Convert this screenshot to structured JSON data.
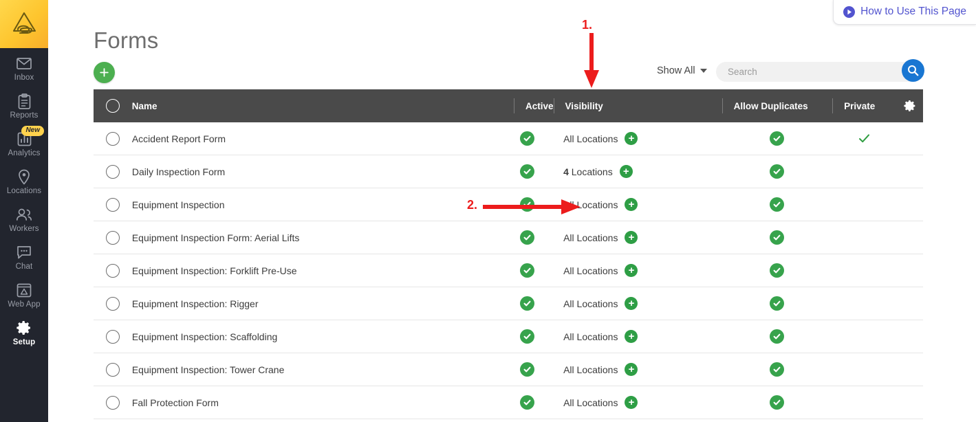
{
  "sidebar": {
    "logo_name": "app-logo",
    "items": [
      {
        "label": "Inbox",
        "icon": "envelope-icon",
        "active": false,
        "badge": ""
      },
      {
        "label": "Reports",
        "icon": "clipboard-icon",
        "active": false,
        "badge": ""
      },
      {
        "label": "Analytics",
        "icon": "bar-chart-icon",
        "active": false,
        "badge": "New"
      },
      {
        "label": "Locations",
        "icon": "map-pin-icon",
        "active": false,
        "badge": ""
      },
      {
        "label": "Workers",
        "icon": "people-icon",
        "active": false,
        "badge": ""
      },
      {
        "label": "Chat",
        "icon": "chat-bubble-icon",
        "active": false,
        "badge": ""
      },
      {
        "label": "Web App",
        "icon": "web-app-icon",
        "active": false,
        "badge": ""
      },
      {
        "label": "Setup",
        "icon": "gear-icon",
        "active": true,
        "badge": ""
      }
    ]
  },
  "howto": {
    "label": "How to Use This Page",
    "icon": "play-circle-icon",
    "color": "#5254cf"
  },
  "header": {
    "title": "Forms",
    "add_label": "+"
  },
  "toolbar": {
    "filter_label": "Show All",
    "search_placeholder": "Search",
    "search_value": "",
    "search_button_icon": "search-icon",
    "search_button_color": "#1976d2"
  },
  "table": {
    "columns": [
      "Name",
      "Active",
      "Visibility",
      "Allow Duplicates",
      "Private"
    ],
    "settings_icon": "gear-icon",
    "header_bg": "#4a4a4a",
    "check_color": "#37a34c",
    "rows": [
      {
        "name": "Accident Report Form",
        "active": true,
        "visibility_count": "",
        "visibility_label": "All Locations",
        "allow_duplicates": true,
        "private": true
      },
      {
        "name": "Daily Inspection Form",
        "active": true,
        "visibility_count": "4",
        "visibility_label": "Locations",
        "allow_duplicates": true,
        "private": false
      },
      {
        "name": "Equipment Inspection",
        "active": true,
        "visibility_count": "",
        "visibility_label": "All Locations",
        "allow_duplicates": true,
        "private": false
      },
      {
        "name": "Equipment Inspection Form: Aerial Lifts",
        "active": true,
        "visibility_count": "",
        "visibility_label": "All Locations",
        "allow_duplicates": true,
        "private": false
      },
      {
        "name": "Equipment Inspection: Forklift Pre-Use",
        "active": true,
        "visibility_count": "",
        "visibility_label": "All Locations",
        "allow_duplicates": true,
        "private": false
      },
      {
        "name": "Equipment Inspection: Rigger",
        "active": true,
        "visibility_count": "",
        "visibility_label": "All Locations",
        "allow_duplicates": true,
        "private": false
      },
      {
        "name": "Equipment Inspection: Scaffolding",
        "active": true,
        "visibility_count": "",
        "visibility_label": "All Locations",
        "allow_duplicates": true,
        "private": false
      },
      {
        "name": "Equipment Inspection: Tower Crane",
        "active": true,
        "visibility_count": "",
        "visibility_label": "All Locations",
        "allow_duplicates": true,
        "private": false
      },
      {
        "name": "Fall Protection Form",
        "active": true,
        "visibility_count": "",
        "visibility_label": "All Locations",
        "allow_duplicates": true,
        "private": false
      }
    ]
  },
  "annotations": {
    "color": "#ec1c1c",
    "marker_1": "1.",
    "marker_2": "2."
  }
}
